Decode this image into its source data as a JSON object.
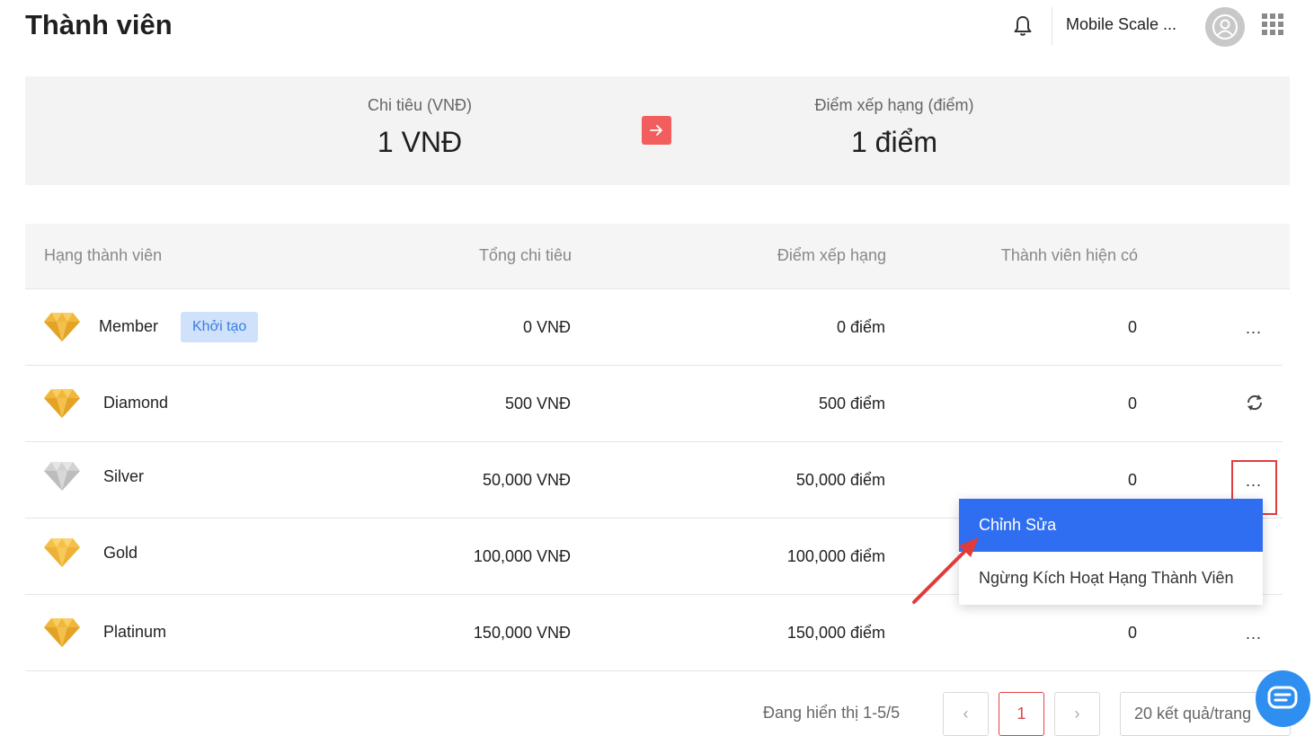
{
  "header": {
    "title": "Thành viên",
    "company": "Mobile Scale ..."
  },
  "summary": {
    "left_label": "Chi tiêu (VNĐ)",
    "left_value": "1 VNĐ",
    "right_label": "Điểm xếp hạng (điểm)",
    "right_value": "1 điểm"
  },
  "table": {
    "headers": {
      "rank": "Hạng thành viên",
      "spend": "Tổng chi tiêu",
      "points": "Điểm xếp hạng",
      "members": "Thành viên hiện có"
    },
    "rows": [
      {
        "name": "Member",
        "badge": "Khởi tạo",
        "spend": "0 VNĐ",
        "points": "0 điểm",
        "members": "0",
        "gem": "gold",
        "action": "more"
      },
      {
        "name": "Diamond",
        "spend": "500 VNĐ",
        "points": "500 điểm",
        "members": "0",
        "gem": "gold",
        "action": "sync"
      },
      {
        "name": "Silver",
        "spend": "50,000 VNĐ",
        "points": "50,000 điểm",
        "members": "0",
        "gem": "silver",
        "action": "more"
      },
      {
        "name": "Gold",
        "spend": "100,000 VNĐ",
        "points": "100,000 điểm",
        "members": "",
        "gem": "gold",
        "action": "none"
      },
      {
        "name": "Platinum",
        "spend": "150,000 VNĐ",
        "points": "150,000 điểm",
        "members": "0",
        "gem": "gold",
        "action": "more"
      }
    ],
    "more_label": "..."
  },
  "dropdown": {
    "edit": "Chỉnh Sửa",
    "deactivate": "Ngừng Kích Hoạt Hạng Thành Viên"
  },
  "pagination": {
    "info": "Đang hiển thị 1-5/5",
    "prev": "‹",
    "current": "1",
    "next": "›",
    "page_size": "20 kết quả/trang"
  },
  "colors": {
    "accent_red": "#f25d5d",
    "menu_blue": "#2f6ef0",
    "badge_bg": "#cfe1fb",
    "gem_gold": "#f1b73a",
    "gem_silver": "#c9c9c9"
  },
  "icons": {
    "bell": "bell-icon",
    "avatar": "user-avatar-icon",
    "apps": "apps-grid-icon",
    "convert": "arrow-right-icon",
    "gem": "diamond-gem-icon",
    "sync": "sync-icon",
    "chat": "chat-icon"
  }
}
